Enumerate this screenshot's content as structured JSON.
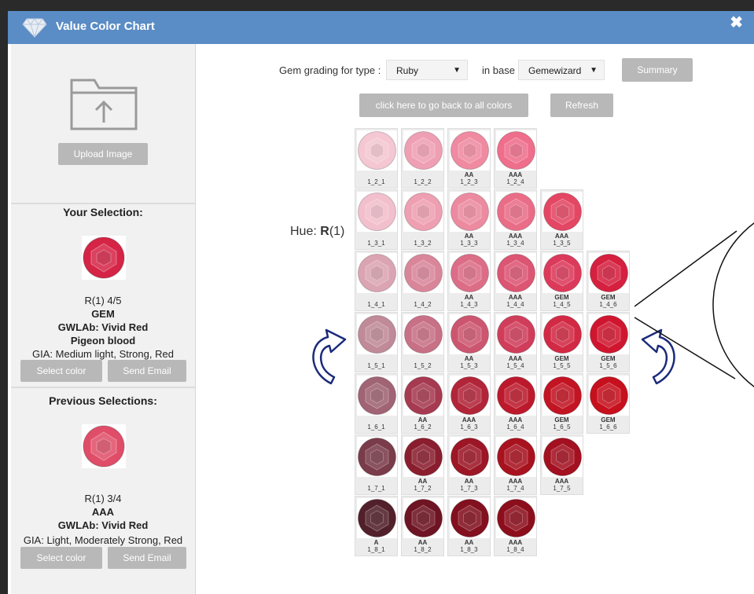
{
  "window": {
    "title": "Value Color Chart",
    "close_symbol": "✖"
  },
  "sidebar": {
    "upload_label": "Upload Image",
    "your_selection": {
      "heading": "Your Selection:",
      "color": "#d52445",
      "code": "R(1) 4/5",
      "grade": "GEM",
      "gwlab": "GWLAb: Vivid Red",
      "name": "Pigeon blood",
      "gia": "GIA: Medium light, Strong, Red",
      "select_label": "Select color",
      "email_label": "Send Email"
    },
    "previous_selection": {
      "heading": "Previous Selections:",
      "color": "#e04d68",
      "code": "R(1) 3/4",
      "grade": "AAA",
      "gwlab": "GWLAb: Vivid Red",
      "gia": "GIA: Light, Moderately Strong, Red",
      "select_label": "Select color",
      "email_label": "Send Email"
    }
  },
  "controls": {
    "grading_label": "Gem grading for type :",
    "type_value": "Ruby",
    "base_label": "in base",
    "base_value": "Gemewizard",
    "summary_label": "Summary",
    "back_label": "click here to go back to all colors",
    "refresh_label": "Refresh"
  },
  "hue": {
    "prefix": "Hue: ",
    "letter": "R",
    "suffix": "(1)"
  },
  "gems": [
    [
      {
        "code": "1_2_1",
        "grade": "",
        "color": "#f4c7d2"
      },
      {
        "code": "1_2_2",
        "grade": "",
        "color": "#ef9fb3"
      },
      {
        "code": "1_2_3",
        "grade": "AA",
        "color": "#ef8aa1"
      },
      {
        "code": "1_2_4",
        "grade": "AAA",
        "color": "#ee6e8c"
      }
    ],
    [
      {
        "code": "1_3_1",
        "grade": "",
        "color": "#f2bfcc"
      },
      {
        "code": "1_3_2",
        "grade": "",
        "color": "#ee9fb1"
      },
      {
        "code": "1_3_3",
        "grade": "AA",
        "color": "#ec8aa0"
      },
      {
        "code": "1_3_4",
        "grade": "AAA",
        "color": "#ea6d88"
      },
      {
        "code": "1_3_5",
        "grade": "AAA",
        "color": "#e34763"
      }
    ],
    [
      {
        "code": "1_4_1",
        "grade": "",
        "color": "#dba4b2"
      },
      {
        "code": "1_4_2",
        "grade": "",
        "color": "#d9869a"
      },
      {
        "code": "1_4_3",
        "grade": "AA",
        "color": "#dc6d87"
      },
      {
        "code": "1_4_4",
        "grade": "AAA",
        "color": "#dc5573"
      },
      {
        "code": "1_4_5",
        "grade": "GEM",
        "color": "#dc3a5a"
      },
      {
        "code": "1_4_6",
        "grade": "GEM",
        "color": "#d5203f"
      }
    ],
    [
      {
        "code": "1_5_1",
        "grade": "",
        "color": "#c08a98"
      },
      {
        "code": "1_5_2",
        "grade": "",
        "color": "#c87085"
      },
      {
        "code": "1_5_3",
        "grade": "AA",
        "color": "#cc566f"
      },
      {
        "code": "1_5_4",
        "grade": "AAA",
        "color": "#d03d5a"
      },
      {
        "code": "1_5_5",
        "grade": "GEM",
        "color": "#d22944"
      },
      {
        "code": "1_5_6",
        "grade": "GEM",
        "color": "#d0162f"
      }
    ],
    [
      {
        "code": "1_6_1",
        "grade": "",
        "color": "#a06474"
      },
      {
        "code": "1_6_2",
        "grade": "AA",
        "color": "#a63a50"
      },
      {
        "code": "1_6_3",
        "grade": "AAA",
        "color": "#b22539"
      },
      {
        "code": "1_6_4",
        "grade": "AAA",
        "color": "#bc1a2c"
      },
      {
        "code": "1_6_5",
        "grade": "GEM",
        "color": "#c21423"
      },
      {
        "code": "1_6_6",
        "grade": "GEM",
        "color": "#c7101d"
      }
    ],
    [
      {
        "code": "1_7_1",
        "grade": "",
        "color": "#7a3c4a"
      },
      {
        "code": "1_7_2",
        "grade": "AA",
        "color": "#8a1e2e"
      },
      {
        "code": "1_7_3",
        "grade": "AA",
        "color": "#9c1626"
      },
      {
        "code": "1_7_4",
        "grade": "AAA",
        "color": "#a8121f"
      },
      {
        "code": "1_7_5",
        "grade": "AAA",
        "color": "#a31020"
      }
    ],
    [
      {
        "code": "1_8_1",
        "grade": "A",
        "color": "#52202a"
      },
      {
        "code": "1_8_2",
        "grade": "AA",
        "color": "#6e1422"
      },
      {
        "code": "1_8_3",
        "grade": "AA",
        "color": "#82101e"
      },
      {
        "code": "1_8_4",
        "grade": "AAA",
        "color": "#8c0e1c"
      }
    ]
  ]
}
